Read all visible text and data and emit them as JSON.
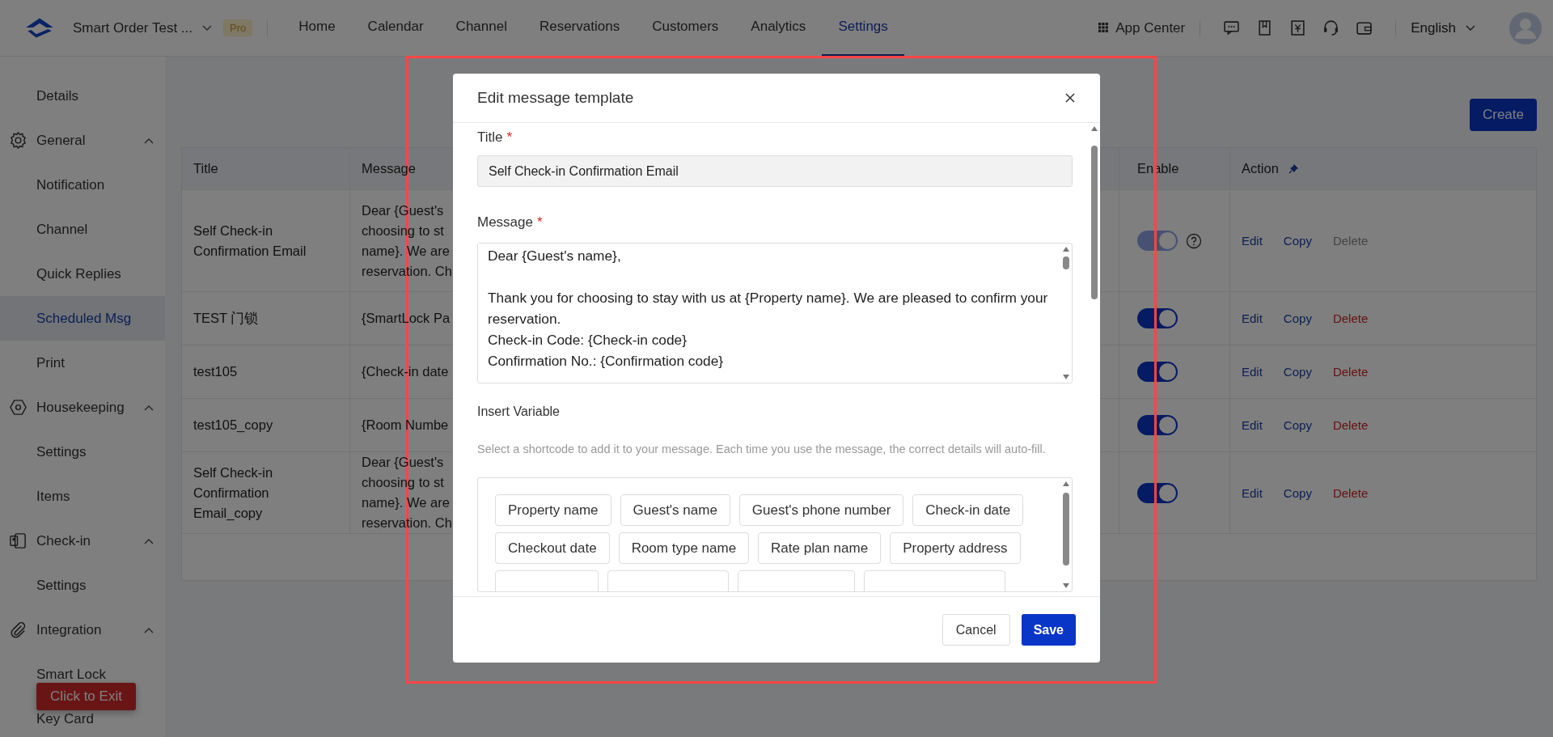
{
  "app_bar": {
    "product": "Smart Order Test ...",
    "plan_badge": "Pro",
    "nav": [
      {
        "label": "Home",
        "selected": false
      },
      {
        "label": "Calendar",
        "selected": false
      },
      {
        "label": "Channel",
        "selected": false
      },
      {
        "label": "Reservations",
        "selected": false
      },
      {
        "label": "Customers",
        "selected": false
      },
      {
        "label": "Analytics",
        "selected": false
      },
      {
        "label": "Settings",
        "selected": true
      }
    ],
    "app_center": "App Center",
    "language": "English"
  },
  "sidebar": {
    "items": [
      {
        "label": "Details",
        "selected": false
      },
      {
        "label": "General",
        "expanded": true,
        "children": [
          {
            "label": "Notification",
            "selected": false
          },
          {
            "label": "Channel",
            "selected": false
          },
          {
            "label": "Quick Replies",
            "selected": false
          },
          {
            "label": "Scheduled Msg",
            "selected": true
          },
          {
            "label": "Print",
            "selected": false
          }
        ]
      },
      {
        "label": "Housekeeping",
        "expanded": true,
        "children": [
          {
            "label": "Settings",
            "selected": false
          },
          {
            "label": "Items",
            "selected": false
          }
        ]
      },
      {
        "label": "Check-in",
        "expanded": true,
        "children": [
          {
            "label": "Settings",
            "selected": false
          }
        ]
      },
      {
        "label": "Integration",
        "expanded": true,
        "children": [
          {
            "label": "Smart Lock",
            "selected": false
          },
          {
            "label": "Key Card",
            "selected": false
          }
        ]
      }
    ]
  },
  "exit_button": "Click to Exit",
  "create_button": "Create",
  "table": {
    "columns": [
      "Title",
      "Message",
      "Enable",
      "Action"
    ],
    "rows": [
      {
        "title": "Self Check-in Confirmation Email",
        "message": [
          "Dear {Guest's",
          "choosing to st",
          "name}. We are",
          "reservation. Ch"
        ],
        "enabled": true,
        "disabled": true,
        "help_icon": true,
        "actions": [
          "Edit",
          "Copy",
          "Delete"
        ]
      },
      {
        "title": "TEST 门锁",
        "message": [
          "{SmartLock Pa"
        ],
        "enabled": true,
        "disabled": false,
        "help_icon": false,
        "actions": [
          "Edit",
          "Copy",
          "Delete"
        ]
      },
      {
        "title": "test105",
        "message": [
          "{Check-in date"
        ],
        "enabled": true,
        "disabled": false,
        "help_icon": false,
        "actions": [
          "Edit",
          "Copy",
          "Delete"
        ]
      },
      {
        "title": "test105_copy",
        "message": [
          "{Room Numbe"
        ],
        "enabled": true,
        "disabled": false,
        "help_icon": false,
        "actions": [
          "Edit",
          "Copy",
          "Delete"
        ]
      },
      {
        "title": "Self Check-in Confirmation Email_copy",
        "message": [
          "Dear {Guest's",
          "choosing to st",
          "name}. We are",
          "reservation. Ch"
        ],
        "enabled": true,
        "disabled": false,
        "help_icon": false,
        "actions": [
          "Edit",
          "Copy",
          "Delete"
        ]
      }
    ]
  },
  "dialog": {
    "title": "Edit message template",
    "title_field": {
      "label": "Title",
      "required_mark": "*",
      "value": "Self Check-in Confirmation Email"
    },
    "message_field": {
      "label": "Message",
      "required_mark": "*",
      "value": "Dear {Guest's name},\n\nThank you for choosing to stay with us at {Property name}. We are pleased to confirm your reservation.\nCheck-in Code: {Check-in code}\nConfirmation No.: {Confirmation code}"
    },
    "insert_variable": {
      "heading": "Insert Variable",
      "help": "Select a shortcode to add it to your message. Each time you use the message, the correct details will auto-fill.",
      "chips": [
        "Property name",
        "Guest's name",
        "Guest's phone number",
        "Check-in date",
        "Checkout date",
        "Room type name",
        "Rate plan name",
        "Property address"
      ]
    },
    "buttons": [
      "Cancel",
      "Save"
    ]
  }
}
